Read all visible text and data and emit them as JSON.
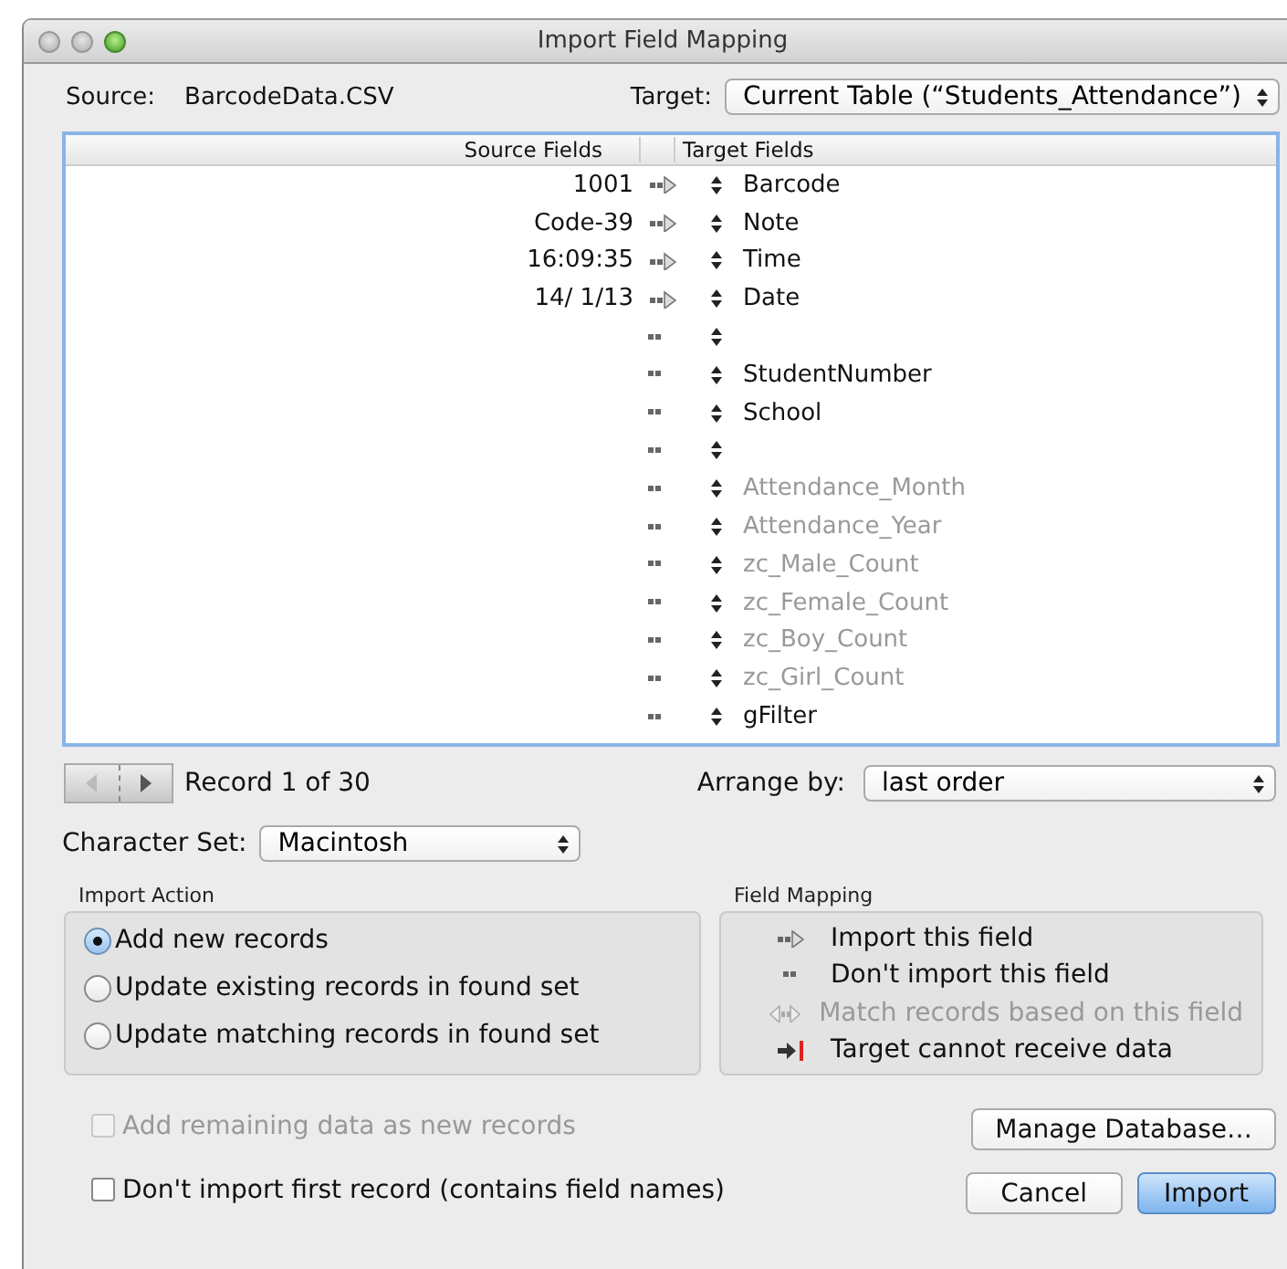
{
  "window": {
    "title": "Import Field Mapping"
  },
  "source": {
    "label": "Source:",
    "value": "BarcodeData.CSV"
  },
  "target": {
    "label": "Target:",
    "value": "Current Table (“Students_Attendance”)"
  },
  "table": {
    "columns": [
      "Source Fields",
      "Target Fields"
    ],
    "rows": [
      {
        "source": "1001",
        "kind": "import",
        "target": "Barcode",
        "disabled": false
      },
      {
        "source": "Code-39",
        "kind": "import",
        "target": "Note",
        "disabled": false
      },
      {
        "source": "16:09:35",
        "kind": "import",
        "target": "Time",
        "disabled": false
      },
      {
        "source": "14/ 1/13",
        "kind": "import",
        "target": "Date",
        "disabled": false
      },
      {
        "kind": "skip"
      },
      {
        "kind": "skip",
        "target": "StudentNumber",
        "disabled": false
      },
      {
        "kind": "skip",
        "target": "School",
        "disabled": false
      },
      {
        "kind": "skip"
      },
      {
        "kind": "skip",
        "target": "Attendance_Month",
        "disabled": true
      },
      {
        "kind": "skip",
        "target": "Attendance_Year",
        "disabled": true
      },
      {
        "kind": "skip",
        "target": "zc_Male_Count",
        "disabled": true
      },
      {
        "kind": "skip",
        "target": "zc_Female_Count",
        "disabled": true
      },
      {
        "kind": "skip",
        "target": "zc_Boy_Count",
        "disabled": true
      },
      {
        "kind": "skip",
        "target": "zc_Girl_Count",
        "disabled": true
      },
      {
        "kind": "skip",
        "target": "gFilter",
        "disabled": false
      }
    ]
  },
  "record_nav": {
    "label": "Record 1 of 30"
  },
  "arrange_by": {
    "label": "Arrange by:",
    "value": "last order"
  },
  "character_set": {
    "label": "Character Set:",
    "value": "Macintosh"
  },
  "import_action": {
    "title": "Import Action",
    "options": [
      {
        "label": "Add new records",
        "selected": true
      },
      {
        "label": "Update existing records in found set",
        "selected": false
      },
      {
        "label": "Update matching records in found set",
        "selected": false
      }
    ]
  },
  "field_mapping": {
    "title": "Field Mapping",
    "items": [
      {
        "kind": "import",
        "label": "Import this field",
        "disabled": false
      },
      {
        "kind": "skip",
        "label": "Don't import this field",
        "disabled": false
      },
      {
        "kind": "match",
        "label": "Match records based on this field",
        "disabled": true
      },
      {
        "kind": "cannot",
        "label": "Target cannot receive data",
        "disabled": false
      }
    ]
  },
  "checkboxes": [
    {
      "label": "Add remaining data as new records",
      "checked": false,
      "disabled": true
    },
    {
      "label": "Don't import first record (contains field names)",
      "checked": false,
      "disabled": false
    }
  ],
  "buttons": {
    "manage": "Manage Database…",
    "cancel": "Cancel",
    "import": "Import"
  }
}
